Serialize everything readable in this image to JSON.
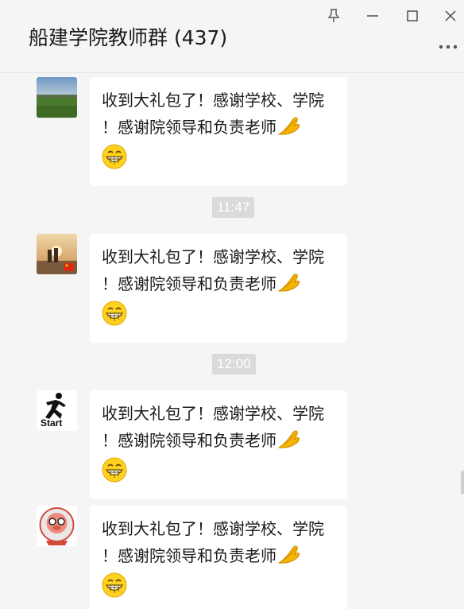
{
  "window": {
    "title": "船建学院教师群 (437)",
    "controls": [
      "pin-icon",
      "minimize-icon",
      "maximize-icon",
      "close-icon"
    ],
    "more_icon": "ellipsis-icon"
  },
  "messages": [
    {
      "line1": "收到大礼包了！感谢学校、学院",
      "line2": "！感谢院领导和负责老师",
      "emojis": [
        "clap-icon",
        "grin-icon"
      ],
      "avatar": "landscape-avatar"
    },
    {
      "line1": "收到大礼包了！感谢学校、学院",
      "line2": "！感谢院领导和负责老师",
      "emojis": [
        "clap-icon",
        "grin-icon"
      ],
      "avatar": "sunset-avatar"
    },
    {
      "line1": "收到大礼包了！感谢学校、学院",
      "line2": "！感谢院领导和负责老师",
      "emojis": [
        "clap-icon",
        "grin-icon"
      ],
      "avatar": "start-runner-avatar",
      "avatar_text": "Start"
    },
    {
      "line1": "收到大礼包了！感谢学校、学院",
      "line2": "！感谢院领导和负责老师",
      "emojis": [
        "clap-icon",
        "grin-icon"
      ],
      "avatar": "cartoon-pig-avatar"
    }
  ],
  "timestamps": [
    "11:47",
    "12:00"
  ],
  "colors": {
    "background": "#f5f5f5",
    "bubble": "#ffffff",
    "timestamp_bg": "#dadada",
    "text": "#1a1a1a"
  }
}
